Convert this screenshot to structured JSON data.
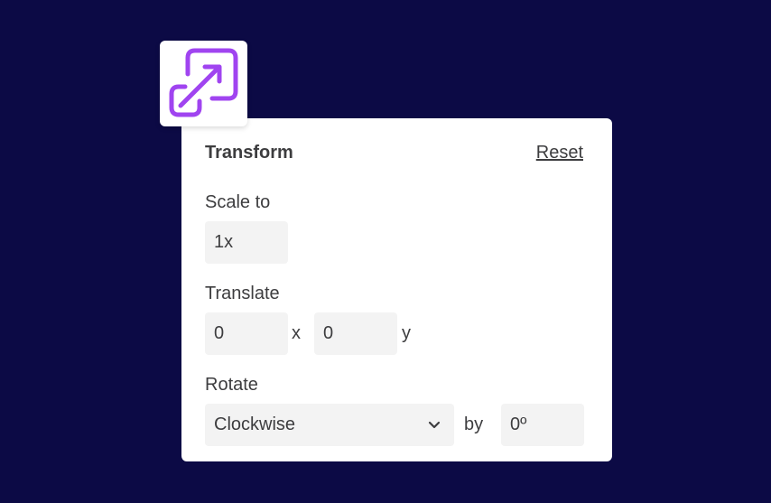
{
  "icon": {
    "name": "expand-arrow-icon",
    "color": "#a044f0"
  },
  "panel": {
    "title": "Transform",
    "reset_label": "Reset",
    "scale": {
      "label": "Scale to",
      "value": "1x"
    },
    "translate": {
      "label": "Translate",
      "x_value": "0",
      "x_suffix": "x",
      "y_value": "0",
      "y_suffix": "y"
    },
    "rotate": {
      "label": "Rotate",
      "direction": "Clockwise",
      "by_label": "by",
      "angle": "0º"
    }
  }
}
